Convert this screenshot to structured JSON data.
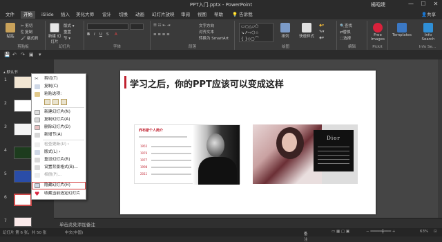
{
  "titlebar": {
    "title": "PPT入门.pptx  -  PowerPoint",
    "user": "楊昭婕",
    "min": "—",
    "max": "☐",
    "close": "✕"
  },
  "tabs": [
    "文件",
    "开始",
    "iSlide",
    "插入",
    "美化大师",
    "设计",
    "切换",
    "动画",
    "幻灯片放映",
    "审阅",
    "视图",
    "帮助"
  ],
  "tell_me": "告诉我",
  "share": "共享",
  "ribbon": {
    "paste": "粘贴",
    "cut": "剪切",
    "copy": "复制",
    "format_painter": "格式刷",
    "new_slide": "新建\n幻灯片",
    "layout": "版式",
    "reset": "重置",
    "section": "节",
    "text_direction": "文字方向",
    "align_text": "对齐文本",
    "smartart": "转换为 SmartArt",
    "arrange": "排列",
    "quick_styles": "快速样式",
    "find": "查找",
    "replace": "替换",
    "select": "选择",
    "free_images": "Free\nImages",
    "templates": "Templates",
    "info_search": "Info\nSearch",
    "groups": {
      "clipboard": "剪贴板",
      "slides": "幻灯片",
      "font": "字体",
      "paragraph": "段落",
      "drawing": "绘图",
      "editing": "编辑",
      "pickit": "Pickit",
      "info": "Info Se..."
    }
  },
  "thumbs": {
    "section_label": "默认节",
    "numbers": [
      "1",
      "2",
      "3",
      "4",
      "5",
      "6",
      "7"
    ]
  },
  "context_menu": {
    "items": [
      {
        "label": "剪切(T)",
        "disabled": false
      },
      {
        "label": "复制(C)",
        "disabled": false
      },
      {
        "label": "粘贴选项:",
        "disabled": false
      },
      {
        "label": "新建幻灯片(N)",
        "disabled": false
      },
      {
        "label": "复制幻灯片(A)",
        "disabled": false
      },
      {
        "label": "删除幻灯片(D)",
        "disabled": false
      },
      {
        "label": "新增节(A)",
        "disabled": false
      },
      {
        "label": "检查更新(U)",
        "disabled": true
      },
      {
        "label": "版式(L)",
        "disabled": false
      },
      {
        "label": "重设幻灯片(R)",
        "disabled": false
      },
      {
        "label": "设置背景格式(B)...",
        "disabled": false
      },
      {
        "label": "相册(P)...",
        "disabled": true
      },
      {
        "label": "隐藏幻灯片(H)",
        "disabled": false,
        "highlighted": true
      },
      {
        "label": "收藏当前选定幻灯片",
        "disabled": false
      }
    ]
  },
  "slide": {
    "title": "学习之后，你的PPT应该可以变成这样",
    "card1_head": "乔布斯个人简介",
    "years": [
      "1955",
      "1976",
      "1977",
      "1998",
      "2011"
    ],
    "brand": "Dior"
  },
  "notes_placeholder": "单击此处添加备注",
  "status": {
    "slide_info": "幻灯片 第 6 张，共 50 张",
    "language": "中文(中国)",
    "notes": "备注",
    "zoom": "63%"
  },
  "colors": {
    "accent_red": "#c0212f",
    "ribbon_bg": "#3a3a3a",
    "app_bg": "#2b2b2b"
  }
}
